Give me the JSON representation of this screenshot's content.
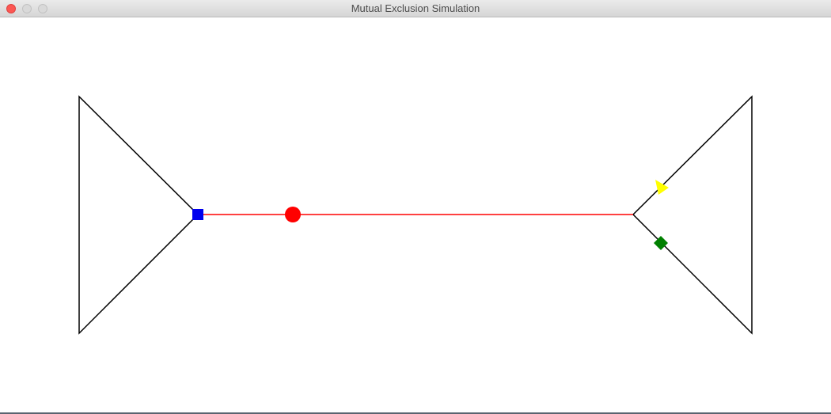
{
  "window": {
    "title": "Mutual Exclusion Simulation"
  },
  "colors": {
    "track": "#000000",
    "critical_section": "#ff0000",
    "circle": "#ff0000",
    "square": "#0000ee",
    "triangle": "#ffff00",
    "diamond": "#008000"
  },
  "processes": [
    {
      "shape": "circle",
      "color": "red",
      "location": "critical-section"
    },
    {
      "shape": "square",
      "color": "blue",
      "location": "left-junction"
    },
    {
      "shape": "triangle",
      "color": "yellow",
      "location": "right-upper-track"
    },
    {
      "shape": "diamond",
      "color": "green",
      "location": "right-lower-track"
    }
  ]
}
